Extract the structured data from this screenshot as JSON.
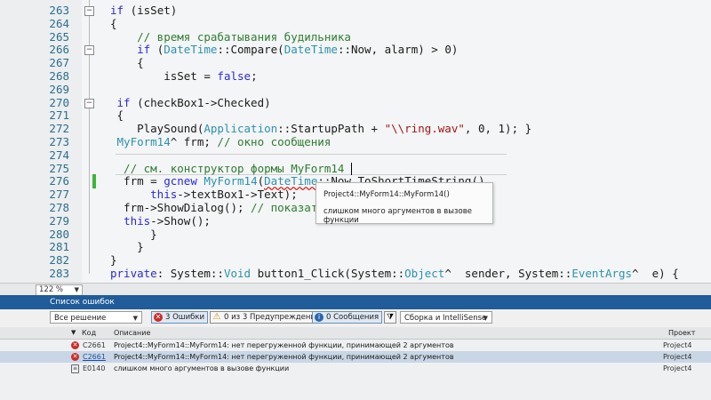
{
  "editor": {
    "lines": [
      {
        "n": "263",
        "seg": [
          {
            "t": "if",
            "c": "kw"
          },
          {
            "t": " (isSet)"
          }
        ]
      },
      {
        "n": "264",
        "seg": [
          {
            "t": "{"
          }
        ]
      },
      {
        "n": "265",
        "seg": [
          {
            "t": "    // время срабатывания будильника",
            "c": "cm"
          }
        ]
      },
      {
        "n": "266",
        "seg": [
          {
            "t": "    "
          },
          {
            "t": "if",
            "c": "kw"
          },
          {
            "t": " ("
          },
          {
            "t": "DateTime",
            "c": "ty"
          },
          {
            "t": "::Compare("
          },
          {
            "t": "DateTime",
            "c": "ty"
          },
          {
            "t": "::Now, alarm) > 0)"
          }
        ]
      },
      {
        "n": "267",
        "seg": [
          {
            "t": "    {"
          }
        ]
      },
      {
        "n": "268",
        "seg": [
          {
            "t": "        isSet = "
          },
          {
            "t": "false",
            "c": "kw"
          },
          {
            "t": ";"
          }
        ]
      },
      {
        "n": "269",
        "seg": []
      },
      {
        "n": "270",
        "seg": [
          {
            "t": " if",
            "c": "kw"
          },
          {
            "t": " (checkBox1->Checked)"
          }
        ]
      },
      {
        "n": "271",
        "seg": [
          {
            "t": " {"
          }
        ]
      },
      {
        "n": "272",
        "seg": [
          {
            "t": "    PlaySound("
          },
          {
            "t": "Application",
            "c": "ty"
          },
          {
            "t": "::StartupPath + "
          },
          {
            "t": "\"\\\\ring.wav\"",
            "c": "st"
          },
          {
            "t": ", 0, 1); }"
          }
        ]
      },
      {
        "n": "273",
        "seg": [
          {
            "t": " MyForm14",
            "c": "ty"
          },
          {
            "t": "^ frm; "
          },
          {
            "t": "// окно сообщения",
            "c": "cm"
          }
        ]
      },
      {
        "n": "274",
        "seg": []
      },
      {
        "n": "275",
        "seg": [
          {
            "t": "  // см. конструктор формы MyForm14 ",
            "c": "cm"
          }
        ]
      },
      {
        "n": "276",
        "seg": [
          {
            "t": "  frm = "
          },
          {
            "t": "gcnew",
            "c": "kw"
          },
          {
            "t": " "
          },
          {
            "t": "MyForm14",
            "c": "ty"
          },
          {
            "t": "("
          },
          {
            "t": "DateTime",
            "c": "ty",
            "s": 1
          },
          {
            "t": "::Now",
            "s": 1
          },
          {
            "t": ".ToShortTimeString(),"
          }
        ]
      },
      {
        "n": "277",
        "seg": [
          {
            "t": "      "
          },
          {
            "t": "this",
            "c": "kw"
          },
          {
            "t": "->textBox1->Text);"
          }
        ]
      },
      {
        "n": "278",
        "seg": [
          {
            "t": "  frm->ShowDialog(); "
          },
          {
            "t": "// показать ок",
            "c": "cm"
          }
        ]
      },
      {
        "n": "279",
        "seg": [
          {
            "t": "  "
          },
          {
            "t": "this",
            "c": "kw"
          },
          {
            "t": "->Show();"
          }
        ]
      },
      {
        "n": "280",
        "seg": [
          {
            "t": "      }"
          }
        ]
      },
      {
        "n": "281",
        "seg": [
          {
            "t": "    }"
          }
        ]
      },
      {
        "n": "282",
        "seg": [
          {
            "t": "}"
          }
        ]
      },
      {
        "n": "283",
        "seg": [
          {
            "t": "private",
            "c": "kw"
          },
          {
            "t": ": System::"
          },
          {
            "t": "Void",
            "c": "ty"
          },
          {
            "t": " button1_Click(System::"
          },
          {
            "t": "Object",
            "c": "ty"
          },
          {
            "t": "^  sender, System::"
          },
          {
            "t": "EventArgs",
            "c": "ty"
          },
          {
            "t": "^  e) {"
          }
        ]
      }
    ],
    "tooltip": {
      "signature": "Project4::MyForm14::MyForm14()",
      "message": "слишком много аргументов в вызове функции"
    },
    "zoom": "122 %"
  },
  "error_list": {
    "title": "Список ошибок",
    "scope": "Все решение",
    "errors_btn": "3 Ошибки",
    "warnings_btn": "0 из 3 Предупреждения",
    "messages_btn": "0 Сообщения",
    "build_filter": "Сборка и IntelliSense",
    "col_code": "Код",
    "col_desc": "Описание",
    "col_project": "Проект",
    "rows": [
      {
        "code": "C2661",
        "desc": "Project4::MyForm14::MyForm14: нет перегруженной функции, принимающей 2 аргументов",
        "project": "Project4",
        "kind": "err"
      },
      {
        "code": "C2661",
        "desc": "Project4::MyForm14::MyForm14: нет перегруженной функции, принимающей 2 аргументов",
        "project": "Project4",
        "kind": "err",
        "selected": true
      },
      {
        "code": "E0140",
        "desc": "слишком много аргументов в вызове функции",
        "project": "Project4",
        "kind": "info"
      }
    ]
  },
  "colors": {
    "accent": "#1f5c99",
    "error": "#cc2a2a",
    "keyword": "#2a2ad6",
    "type": "#2b91af",
    "comment": "#2e7d32"
  }
}
